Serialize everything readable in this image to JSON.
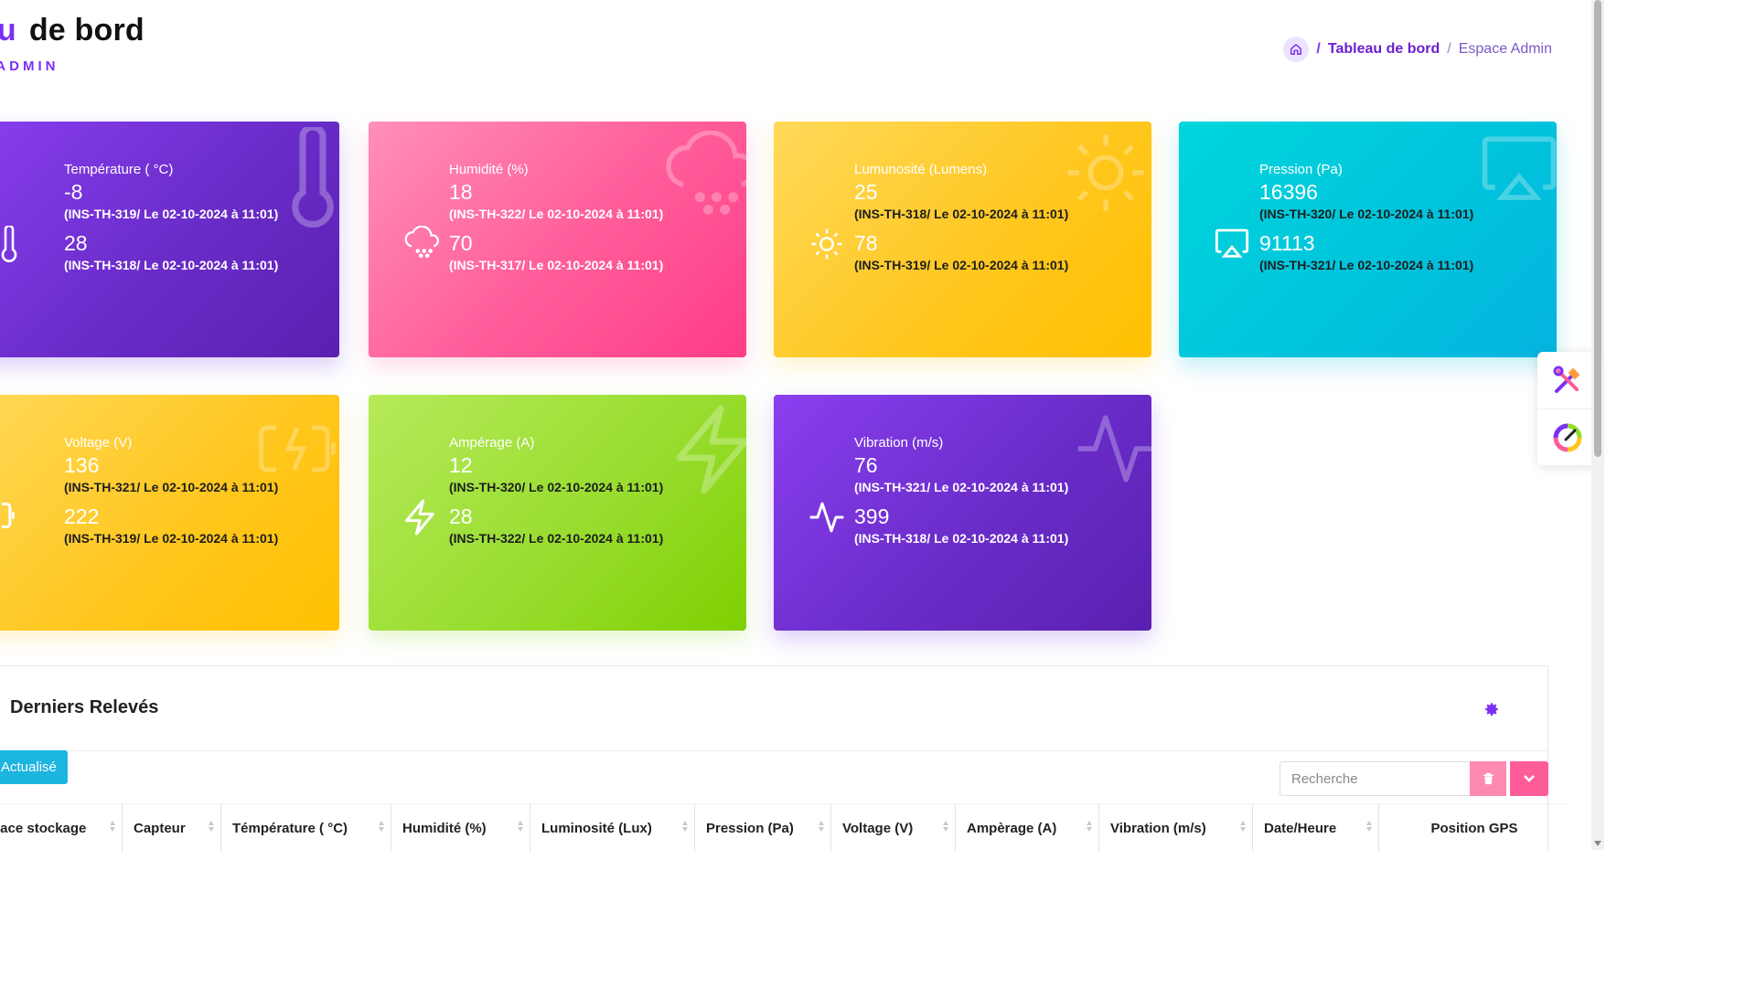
{
  "header": {
    "title_part1": "bleau",
    "title_part2": "de bord",
    "subtitle": "ACE ADMIN"
  },
  "breadcrumb": {
    "separator": "/",
    "active": "Tableau de bord",
    "current": "Espace Admin"
  },
  "cards": [
    {
      "title": "Température ( °C)",
      "value1": "-8",
      "detail1": "(INS-TH-319/ Le 02-10-2024 à 11:01)",
      "value2": "28",
      "detail2": "(INS-TH-318/ Le 02-10-2024 à 11:01)",
      "icon": "thermometer-icon",
      "color": "#7b2ff7"
    },
    {
      "title": "Humidité (%)",
      "value1": "18",
      "detail1": "(INS-TH-322/ Le 02-10-2024 à 11:01)",
      "value2": "70",
      "detail2": "(INS-TH-317/ Le 02-10-2024 à 11:01)",
      "icon": "cloud-drizzle-icon",
      "color": "#ff5c9a"
    },
    {
      "title": "Lumunosité (Lumens)",
      "value1": "25",
      "detail1": "(INS-TH-318/ Le 02-10-2024 à 11:01)",
      "value2": "78",
      "detail2": "(INS-TH-319/ Le 02-10-2024 à 11:01)",
      "icon": "sun-icon",
      "color": "#ffc61c"
    },
    {
      "title": "Pression (Pa)",
      "value1": "16396",
      "detail1": "(INS-TH-320/ Le 02-10-2024 à 11:01)",
      "value2": "91113",
      "detail2": "(INS-TH-321/ Le 02-10-2024 à 11:01)",
      "icon": "airplay-icon",
      "color": "#00c2dc"
    },
    {
      "title": "Voltage (V)",
      "value1": "136",
      "detail1": "(INS-TH-321/ Le 02-10-2024 à 11:01)",
      "value2": "222",
      "detail2": "(INS-TH-319/ Le 02-10-2024 à 11:01)",
      "icon": "battery-charging-icon",
      "color": "#ffc61c"
    },
    {
      "title": "Ampérage (A)",
      "value1": "12",
      "detail1": "(INS-TH-320/ Le 02-10-2024 à 11:01)",
      "value2": "28",
      "detail2": "(INS-TH-322/ Le 02-10-2024 à 11:01)",
      "icon": "lightning-icon",
      "color": "#96dc2c"
    },
    {
      "title": "Vibration (m/s)",
      "value1": "76",
      "detail1": "(INS-TH-321/ Le 02-10-2024 à 11:01)",
      "value2": "399",
      "detail2": "(INS-TH-318/ Le 02-10-2024 à 11:01)",
      "icon": "activity-icon",
      "color": "#7b2ff7"
    }
  ],
  "panel": {
    "title": "Derniers Relevés",
    "refresh_label": "Actualisé",
    "search_placeholder": "Recherche",
    "columns": [
      "pace stockage",
      "Capteur",
      "Témpérature ( °C)",
      "Humidité (%)",
      "Luminosité (Lux)",
      "Pression (Pa)",
      "Voltage (V)",
      "Ampèrage (A)",
      "Vibration (m/s)",
      "Date/Heure",
      "Position GPS"
    ]
  }
}
